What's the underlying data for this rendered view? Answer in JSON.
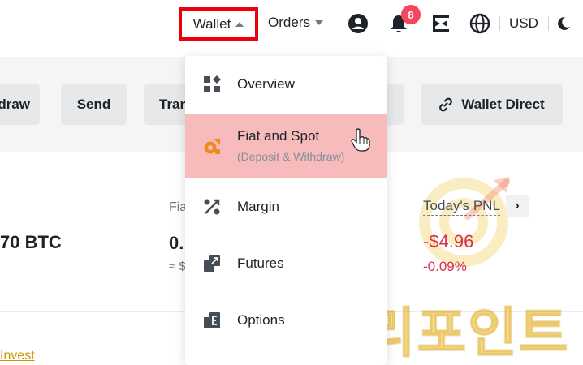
{
  "nav": {
    "wallet_label": "Wallet",
    "orders_label": "Orders",
    "notification_count": "8",
    "currency": "USD"
  },
  "actions": {
    "withdraw_label": "draw",
    "send_label": "Send",
    "transfer_label": "Tran",
    "wallet_direct_label": "Wallet Direct"
  },
  "balance": {
    "btc_value": "70 BTC",
    "fiat_label": "Fia",
    "fiat_value": "0.",
    "fiat_approx": "≈ $"
  },
  "pnl": {
    "title": "Today's PNL",
    "value": "-$4.96",
    "percent": "-0.09%"
  },
  "invest_link": "Invest",
  "wallet_menu": {
    "items": [
      {
        "label": "Overview",
        "icon": "grid-icon"
      },
      {
        "label": "Fiat and Spot",
        "sublabel": "(Deposit & Withdraw)",
        "icon": "fiat-spot-icon",
        "selected": true
      },
      {
        "label": "Margin",
        "icon": "margin-icon"
      },
      {
        "label": "Futures",
        "icon": "futures-icon"
      },
      {
        "label": "Options",
        "icon": "options-icon"
      }
    ]
  },
  "watermark": "랠리포인트",
  "colors": {
    "highlight_border": "#e8000b",
    "selected_bg": "#f8bbbc",
    "negative": "#d9304e",
    "accent": "#f0b90b",
    "badge": "#f6465d"
  }
}
